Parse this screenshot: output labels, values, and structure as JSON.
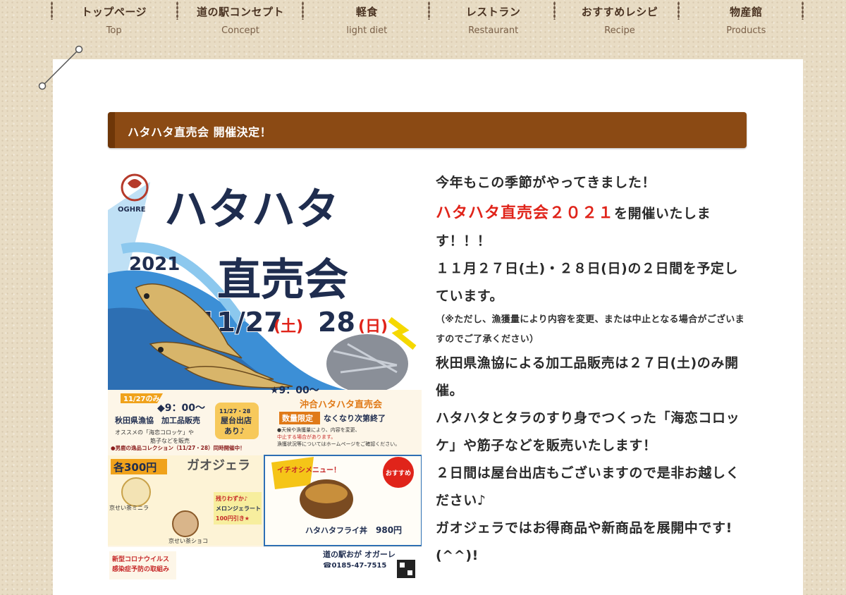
{
  "nav": {
    "items": [
      {
        "jp": "トップページ",
        "en": "Top"
      },
      {
        "jp": "道の駅コンセプト",
        "en": "Concept"
      },
      {
        "jp": "軽食",
        "en": "light diet"
      },
      {
        "jp": "レストラン",
        "en": "Restaurant"
      },
      {
        "jp": "おすすめレシピ",
        "en": "Recipe"
      },
      {
        "jp": "物産館",
        "en": "Products"
      }
    ]
  },
  "post": {
    "title": "ハタハタ直売会 開催決定！"
  },
  "poster": {
    "logo_text": "OGHRE",
    "title_line1": "ハタハタ",
    "year": "2021",
    "title_line2": "直売会",
    "date_main": "11/27",
    "day1": "(土)",
    "date2": "28",
    "day2": "(日)",
    "badge_only": "11/27のみ",
    "time1": "◆9：00〜",
    "shop1": "秋田県漁協　加工品販売",
    "shop1_desc1": "オススメの「海恋コロッケ」や",
    "shop1_desc2": "筋子などを販売",
    "stall_badge1": "11/27・28",
    "stall_badge2": "屋台出店",
    "stall_badge3": "あり♪",
    "time2": "★9：00〜",
    "shop2": "沖合ハタハタ直売会",
    "limited": "数量限定",
    "until": "なくなり次第終了",
    "notice1": "●天候や漁獲量により、内容を変更、",
    "notice2": "中止する場合があります。",
    "notice3": "漁獲状況等についてはホームページをご確認ください。",
    "collection": "●男鹿の逸品コレクション（11/27・28）同時開催中！",
    "price_each": "各300円",
    "gelato": "ガオジェラ",
    "gelato_flavor1": "京せい茶ミニラ",
    "gelato_flavor2": "京せい茶ショコ",
    "melon_discount1": "残りわずか♪",
    "melon_discount2": "メロンジェラート",
    "melon_discount3": "100円引き★",
    "recommend": "イチオシメニュー！",
    "osusume": "おすすめ",
    "dish": "ハタハタフライ丼",
    "dish_price": "980円",
    "station": "道の駅おが オガーレ",
    "phone": "☎0185-47-7515",
    "covid1": "新型コロナウイルス",
    "covid2": "感染症予防の取組み"
  },
  "article": {
    "line1": "今年もこの季節がやってきました！",
    "highlight": "ハタハタ直売会２０２１",
    "line2_rest": "を開催いたします！！！",
    "line3": "１１月２７日(土)・２８日(日)の２日間を予定しています。",
    "note": "（※ただし、漁獲量により内容を変更、または中止となる場合がございますのでご了承ください）",
    "line4": "秋田県漁協による加工品販売は２７日(土)のみ開催。",
    "line5": "ハタハタとタラのすり身でつくった「海恋コロッケ」や筋子などを販売いたします！",
    "line6": "２日間は屋台出店もございますので是非お越しください♪",
    "line7": "ガオジェラではお得商品や新商品を展開中です!(^^)!"
  },
  "colors": {
    "title_bar": "#8b4a14",
    "highlight_red": "#e0241a",
    "poster_navy": "#1f2d4f",
    "poster_wave": "#3c8fd6"
  }
}
